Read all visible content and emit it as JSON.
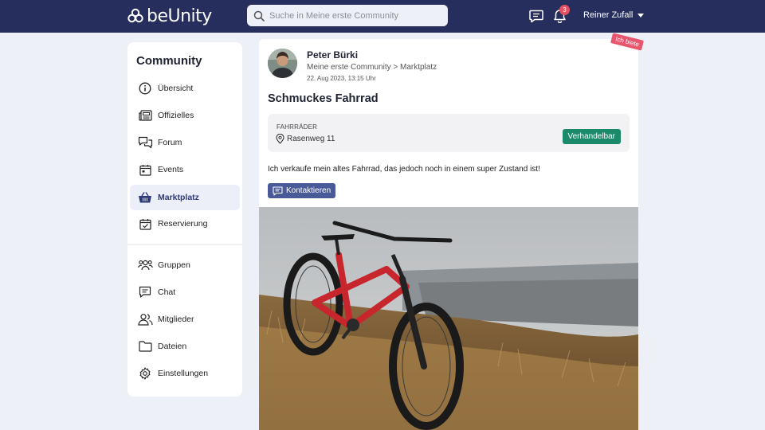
{
  "header": {
    "logo_text": "beUnity",
    "search_placeholder": "Suche in Meine erste Community",
    "notifications_count": "3",
    "user_name": "Reiner Zufall"
  },
  "sidebar": {
    "title": "Community",
    "items": [
      {
        "label": "Übersicht",
        "icon": "info-icon"
      },
      {
        "label": "Offizielles",
        "icon": "newspaper-icon"
      },
      {
        "label": "Forum",
        "icon": "forum-icon"
      },
      {
        "label": "Events",
        "icon": "calendar-icon"
      },
      {
        "label": "Marktplatz",
        "icon": "basket-icon",
        "active": true
      },
      {
        "label": "Reservierung",
        "icon": "calendar-check-icon"
      },
      {
        "label": "Gruppen",
        "icon": "groups-icon"
      },
      {
        "label": "Chat",
        "icon": "chat-icon"
      },
      {
        "label": "Mitglieder",
        "icon": "members-icon"
      },
      {
        "label": "Dateien",
        "icon": "folder-icon"
      },
      {
        "label": "Einstellungen",
        "icon": "gear-icon"
      }
    ]
  },
  "post": {
    "tag": "Ich biete",
    "author": "Peter Bürki",
    "breadcrumb": "Meine erste Community > Marktplatz",
    "date": "22. Aug 2023, 13:15 Uhr",
    "title": "Schmuckes Fahrrad",
    "category": "FAHRRÄDER",
    "location": "Rasenweg 11",
    "price_label": "Verhandelbar",
    "description": "Ich verkaufe mein altes Fahrrad, das jedoch noch in einem super Zustand ist!",
    "contact_label": "Kontaktieren"
  },
  "colors": {
    "header_bg": "#252e5c",
    "accent": "#2d3a7c",
    "negotiable": "#1b8a6b",
    "tag": "#e8566d",
    "badge": "#e4505f"
  }
}
